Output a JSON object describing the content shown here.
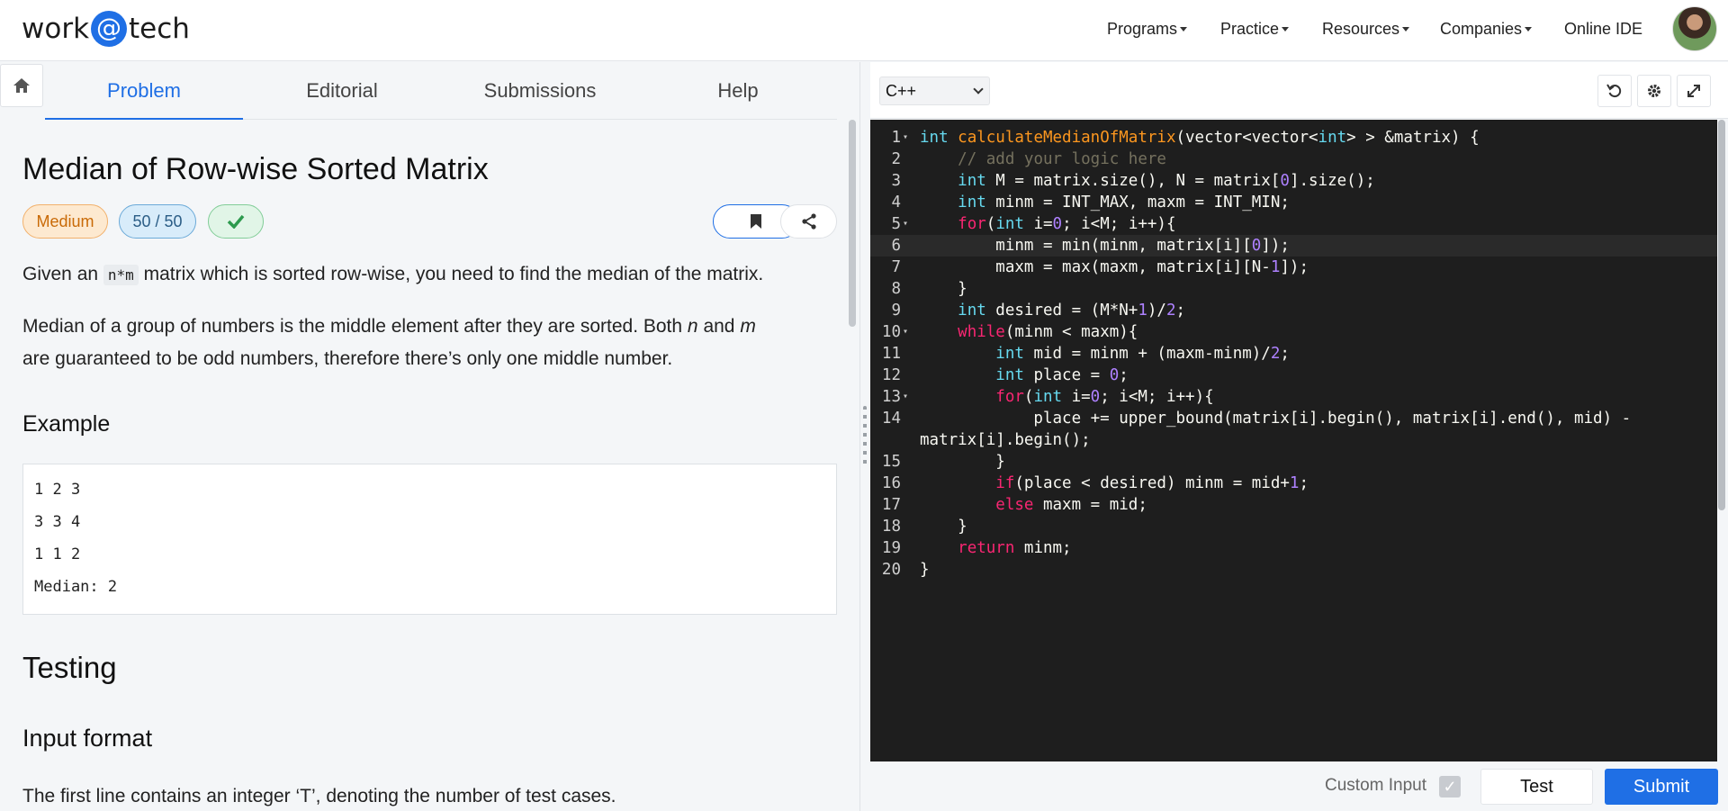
{
  "navbar": {
    "logo_left": "work",
    "logo_at": "@",
    "logo_right": "tech",
    "links": [
      "Programs",
      "Practice",
      "Resources",
      "Companies",
      "Online IDE"
    ]
  },
  "tabs": [
    "Problem",
    "Editorial",
    "Submissions",
    "Help"
  ],
  "problem": {
    "title": "Median of Row-wise Sorted Matrix",
    "difficulty": "Medium",
    "score": "50 / 50",
    "solved_icon": "check-icon",
    "desc_pre": "Given an ",
    "desc_code": "n*m",
    "desc_post": " matrix which is sorted row-wise, you need to find the median of the matrix.",
    "desc2_a": "Median of a group of numbers is the middle element after they are sorted. Both ",
    "desc2_n": "n",
    "desc2_and": " and ",
    "desc2_m": "m",
    "desc2_b": "are guaranteed to be odd numbers, therefore there’s only one middle number.",
    "example_heading": "Example",
    "example_lines": [
      "1 2 3",
      "3 3 4",
      "1 1 2",
      "Median: 2"
    ],
    "testing_heading": "Testing",
    "input_heading": "Input format",
    "input_text": "The first line contains an integer ‘T’, denoting the number of test cases."
  },
  "editor": {
    "language": "C++",
    "line_numbers": [
      "1",
      "2",
      "3",
      "4",
      "5",
      "6",
      "7",
      "8",
      "9",
      "10",
      "11",
      "12",
      "13",
      "14",
      "",
      "15",
      "16",
      "17",
      "18",
      "19",
      "20"
    ]
  },
  "bottom": {
    "custom_input_label": "Custom Input",
    "test_label": "Test",
    "submit_label": "Submit"
  },
  "colors": {
    "accent": "#1f6fe5",
    "editor_bg": "#1e1e1e",
    "medium_badge": "#fde9d0"
  }
}
